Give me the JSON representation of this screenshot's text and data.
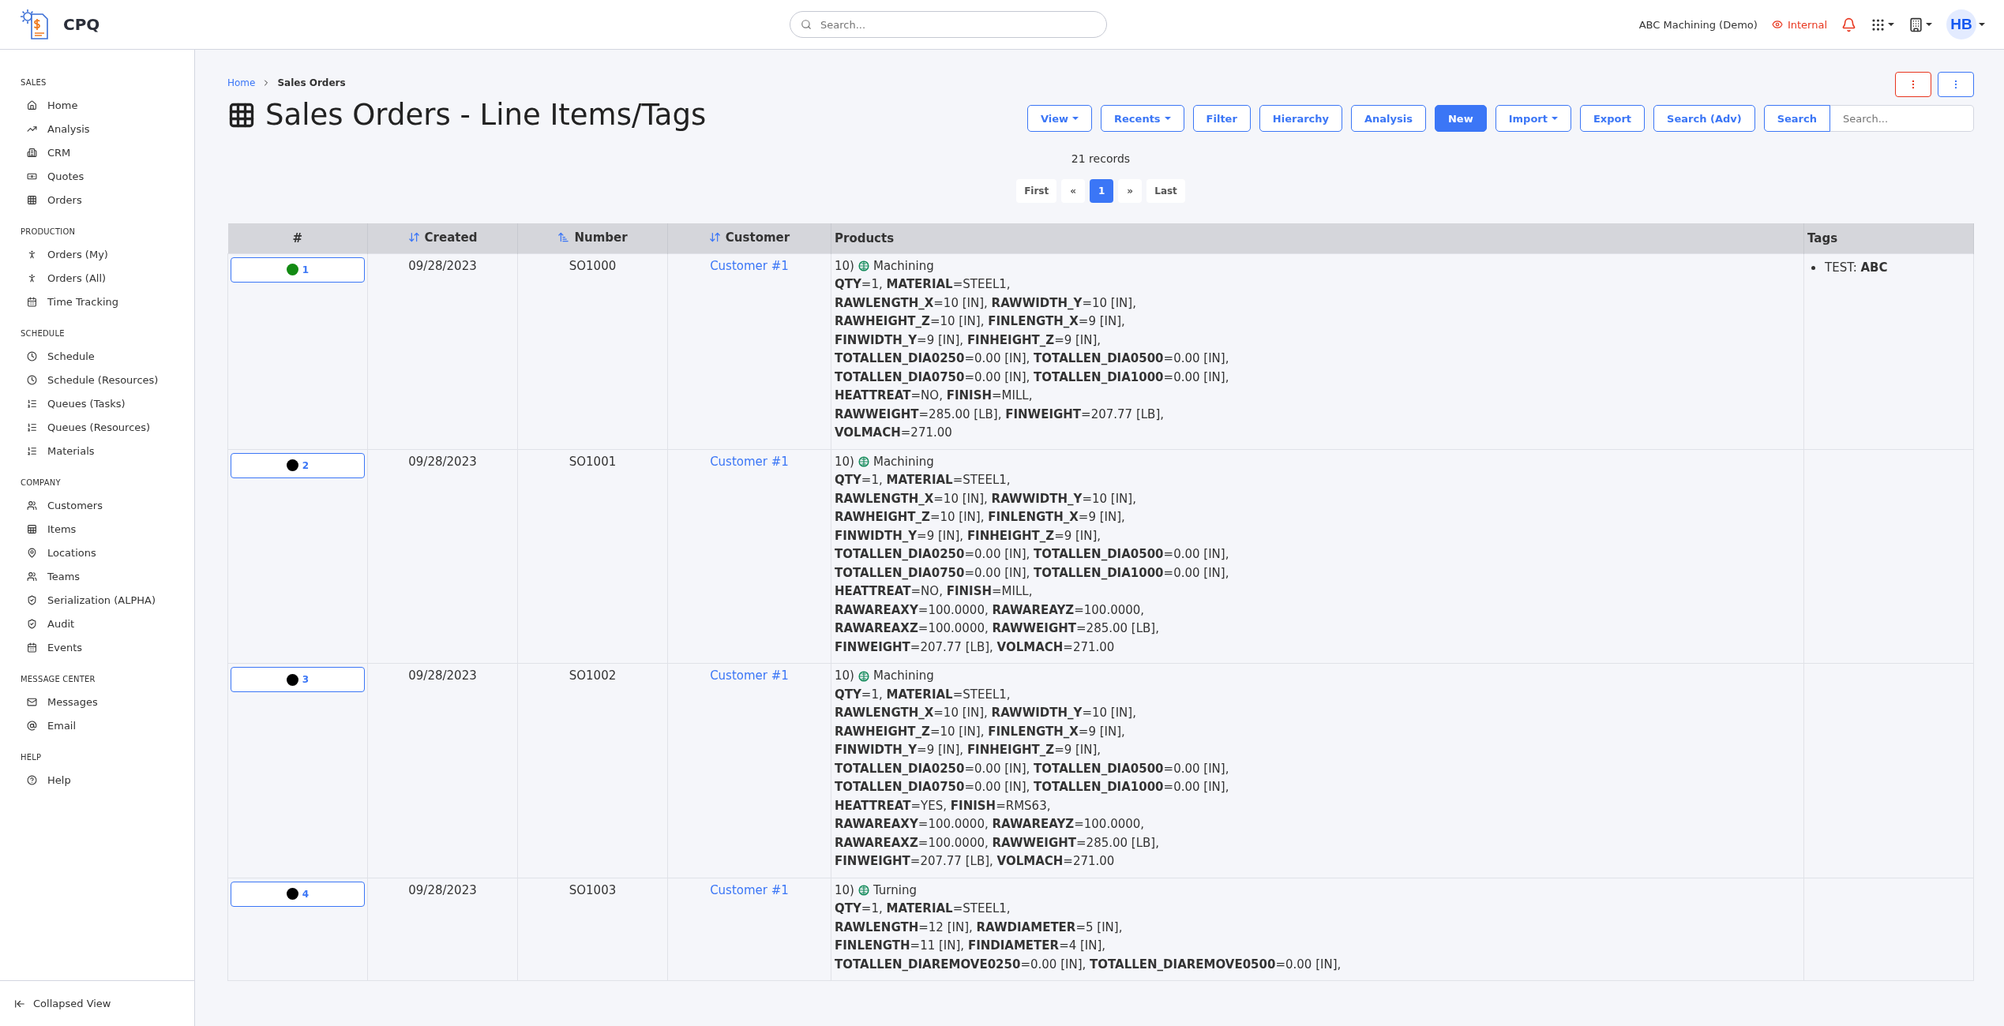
{
  "app": {
    "name": "CPQ"
  },
  "top_search": {
    "placeholder": "Search..."
  },
  "top_bar": {
    "company": "ABC Machining (Demo)",
    "mode": "Internal",
    "avatar": "HB"
  },
  "sidebar": {
    "sections": [
      {
        "title": "SALES",
        "items": [
          "Home",
          "Analysis",
          "CRM",
          "Quotes",
          "Orders"
        ]
      },
      {
        "title": "PRODUCTION",
        "items": [
          "Orders (My)",
          "Orders (All)",
          "Time Tracking"
        ]
      },
      {
        "title": "SCHEDULE",
        "items": [
          "Schedule",
          "Schedule (Resources)",
          "Queues (Tasks)",
          "Queues (Resources)",
          "Materials"
        ]
      },
      {
        "title": "COMPANY",
        "items": [
          "Customers",
          "Items",
          "Locations",
          "Teams",
          "Serialization (ALPHA)",
          "Audit",
          "Events"
        ]
      },
      {
        "title": "MESSAGE CENTER",
        "items": [
          "Messages",
          "Email"
        ]
      },
      {
        "title": "HELP",
        "items": [
          "Help"
        ]
      }
    ],
    "footer": "Collapsed View"
  },
  "breadcrumb": [
    {
      "label": "Home",
      "link": true
    },
    {
      "label": "Sales Orders",
      "link": false
    }
  ],
  "title": "Sales Orders - Line Items/Tags",
  "toolbar": [
    {
      "label": "View",
      "kind": "outline",
      "dropdown": true
    },
    {
      "label": "Recents",
      "kind": "outline",
      "dropdown": true
    },
    {
      "label": "Filter",
      "kind": "outline",
      "dropdown": false
    },
    {
      "label": "Hierarchy",
      "kind": "outline",
      "dropdown": false
    },
    {
      "label": "Analysis",
      "kind": "outline",
      "dropdown": false
    },
    {
      "label": "New",
      "kind": "primary",
      "dropdown": false
    },
    {
      "label": "Import",
      "kind": "outline",
      "dropdown": true
    },
    {
      "label": "Export",
      "kind": "outline",
      "dropdown": false
    },
    {
      "label": "Search (Adv)",
      "kind": "outline",
      "dropdown": false
    },
    {
      "label": "Search",
      "kind": "outline",
      "dropdown": false
    }
  ],
  "search": {
    "placeholder": "Search..."
  },
  "records": "21 records",
  "pagination": [
    {
      "label": "First",
      "selected": false
    },
    {
      "label": "«",
      "selected": false
    },
    {
      "label": "1",
      "selected": true
    },
    {
      "label": "»",
      "selected": false
    },
    {
      "label": "Last",
      "selected": false
    }
  ],
  "table": {
    "columns": [
      {
        "label": "#"
      },
      {
        "label": "Created",
        "sorted": false
      },
      {
        "label": "Number",
        "sorted": true
      },
      {
        "label": "Customer",
        "sorted": false
      },
      {
        "label": "Products"
      },
      {
        "label": "Tags"
      }
    ],
    "rows": [
      {
        "index": "1",
        "color": "#138a13",
        "created": "09/28/2023",
        "number": "SO1000",
        "customer": "Customer #1",
        "product_no": "10)",
        "product": "Machining",
        "attributes": [
          "**QTY**=1, **MATERIAL**=STEEL1,",
          "**RAWLENGTH_X**=10 [IN], **RAWWIDTH_Y**=10 [IN],",
          "**RAWHEIGHT_Z**=10 [IN], **FINLENGTH_X**=9 [IN],",
          "**FINWIDTH_Y**=9 [IN], **FINHEIGHT_Z**=9 [IN],",
          "**TOTALLEN_DIA0250**=0.00 [IN], **TOTALLEN_DIA0500**=0.00 [IN],",
          "**TOTALLEN_DIA0750**=0.00 [IN], **TOTALLEN_DIA1000**=0.00 [IN],",
          "**HEATTREAT**=NO, **FINISH**=MILL,",
          "**RAWWEIGHT**=285.00 [LB], **FINWEIGHT**=207.77 [LB],",
          "**VOLMACH**=271.00"
        ],
        "tags": [
          "TEST: **ABC**"
        ]
      },
      {
        "index": "2",
        "color": "#000000",
        "created": "09/28/2023",
        "number": "SO1001",
        "customer": "Customer #1",
        "product_no": "10)",
        "product": "Machining",
        "attributes": [
          "**QTY**=1, **MATERIAL**=STEEL1,",
          "**RAWLENGTH_X**=10 [IN], **RAWWIDTH_Y**=10 [IN],",
          "**RAWHEIGHT_Z**=10 [IN], **FINLENGTH_X**=9 [IN],",
          "**FINWIDTH_Y**=9 [IN], **FINHEIGHT_Z**=9 [IN],",
          "**TOTALLEN_DIA0250**=0.00 [IN], **TOTALLEN_DIA0500**=0.00 [IN],",
          "**TOTALLEN_DIA0750**=0.00 [IN], **TOTALLEN_DIA1000**=0.00 [IN],",
          "**HEATTREAT**=NO, **FINISH**=MILL,",
          "**RAWAREAXY**=100.0000, **RAWAREAYZ**=100.0000,",
          "**RAWAREAXZ**=100.0000, **RAWWEIGHT**=285.00 [LB],",
          "**FINWEIGHT**=207.77 [LB], **VOLMACH**=271.00"
        ],
        "tags": []
      },
      {
        "index": "3",
        "color": "#000000",
        "created": "09/28/2023",
        "number": "SO1002",
        "customer": "Customer #1",
        "product_no": "10)",
        "product": "Machining",
        "attributes": [
          "**QTY**=1, **MATERIAL**=STEEL1,",
          "**RAWLENGTH_X**=10 [IN], **RAWWIDTH_Y**=10 [IN],",
          "**RAWHEIGHT_Z**=10 [IN], **FINLENGTH_X**=9 [IN],",
          "**FINWIDTH_Y**=9 [IN], **FINHEIGHT_Z**=9 [IN],",
          "**TOTALLEN_DIA0250**=0.00 [IN], **TOTALLEN_DIA0500**=0.00 [IN],",
          "**TOTALLEN_DIA0750**=0.00 [IN], **TOTALLEN_DIA1000**=0.00 [IN],",
          "**HEATTREAT**=YES, **FINISH**=RMS63,",
          "**RAWAREAXY**=100.0000, **RAWAREAYZ**=100.0000,",
          "**RAWAREAXZ**=100.0000, **RAWWEIGHT**=285.00 [LB],",
          "**FINWEIGHT**=207.77 [LB], **VOLMACH**=271.00"
        ],
        "tags": []
      },
      {
        "index": "4",
        "color": "#000000",
        "created": "09/28/2023",
        "number": "SO1003",
        "customer": "Customer #1",
        "product_no": "10)",
        "product": "Turning",
        "attributes": [
          "**QTY**=1, **MATERIAL**=STEEL1,",
          "**RAWLENGTH**=12 [IN], **RAWDIAMETER**=5 [IN],",
          "**FINLENGTH**=11 [IN], **FINDIAMETER**=4 [IN],",
          "**TOTALLEN_DIAREMOVE0250**=0.00 [IN], **TOTALLEN_DIAREMOVE0500**=0.00 [IN],"
        ],
        "tags": []
      }
    ]
  }
}
